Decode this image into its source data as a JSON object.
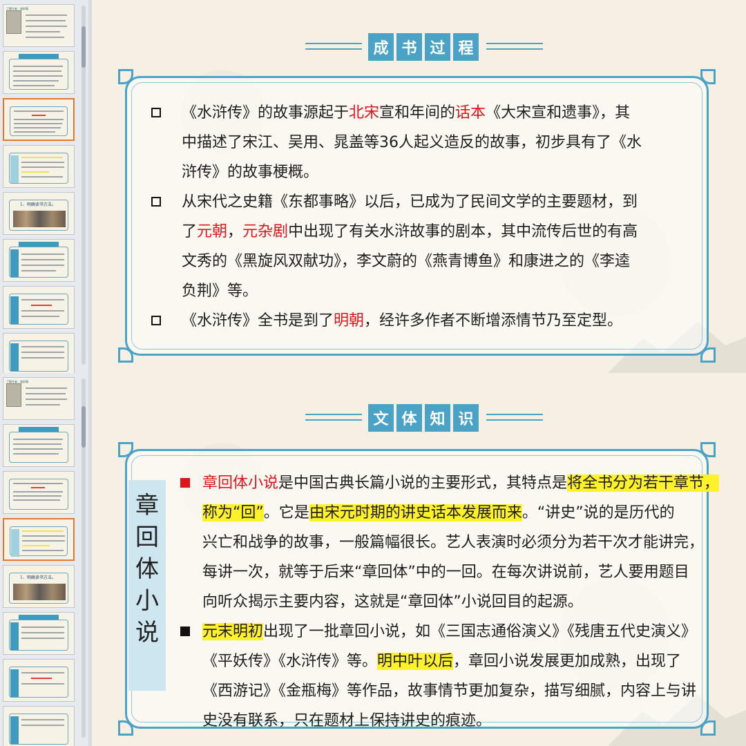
{
  "top_slide": {
    "heading": [
      "成",
      "书",
      "过",
      "程"
    ],
    "paragraphs": [
      {
        "bullet": "hollow-square",
        "lines": [
          [
            {
              "t": "《水浒传》的故事源起于"
            },
            {
              "t": "北宋",
              "c": "red"
            },
            {
              "t": "宣和年间的"
            },
            {
              "t": "话本",
              "c": "red"
            },
            {
              "t": "《大宋宣和遗事》，其"
            }
          ],
          [
            {
              "t": "中描述了宋江、吴用、晁盖等36人起义造反的故事，初步具有了《水"
            }
          ],
          [
            {
              "t": "浒传》的故事梗概。"
            }
          ]
        ]
      },
      {
        "bullet": "hollow-square",
        "lines": [
          [
            {
              "t": "从宋代之史籍《东都事略》以后，已成为了民间文学的主要题材，到"
            }
          ],
          [
            {
              "t": "了"
            },
            {
              "t": "元朝",
              "c": "red"
            },
            {
              "t": "，"
            },
            {
              "t": "元杂剧",
              "c": "red"
            },
            {
              "t": "中出现了有关水浒故事的剧本，其中流传后世的有高"
            }
          ],
          [
            {
              "t": "文秀的《黑旋风双献功》，李文蔚的《燕青博鱼》和康进之的《李逵"
            }
          ],
          [
            {
              "t": "负荆》等。"
            }
          ]
        ]
      },
      {
        "bullet": "hollow-square",
        "lines": [
          [
            {
              "t": "《水浒传》全书是到了"
            },
            {
              "t": "明朝",
              "c": "red"
            },
            {
              "t": "，经许多作者不断增添情节乃至定型。"
            }
          ]
        ]
      }
    ]
  },
  "bottom_slide": {
    "heading": [
      "文",
      "体",
      "知",
      "识"
    ],
    "side_label": [
      "章",
      "回",
      "体",
      "小",
      "说"
    ],
    "paragraphs": [
      {
        "bullet": "red-square",
        "lines": [
          [
            {
              "t": "章回体小说",
              "c": "red"
            },
            {
              "t": "是中国古典长篇小说的主要形式，其特点是"
            },
            {
              "t": "将全书分为若干章节，",
              "h": 1
            }
          ],
          [
            {
              "t": "称为“回”",
              "h": 1
            },
            {
              "t": "。它是"
            },
            {
              "t": "由宋元时期的讲史话本发展而来",
              "h": 1
            },
            {
              "t": "。“讲史”说的是历代的"
            }
          ],
          [
            {
              "t": "兴亡和战争的故事，一般篇幅很长。艺人表演时必须分为若干次才能讲完，"
            }
          ],
          [
            {
              "t": "每讲一次，就等于后来“章回体”中的一回。在每次讲说前，艺人要用题目"
            }
          ],
          [
            {
              "t": "向听众揭示主要内容，这就是“章回体”小说回目的起源。"
            }
          ]
        ]
      },
      {
        "bullet": "black-square",
        "lines": [
          [
            {
              "t": "元末明初",
              "h": 1
            },
            {
              "t": "出现了一批章回小说，如《三国志通俗演义》《残唐五代史演义》"
            }
          ],
          [
            {
              "t": "《平妖传》《水浒传》等。"
            },
            {
              "t": "明中叶以后",
              "h": 1
            },
            {
              "t": "，章回小说发展更加成熟，出现了"
            }
          ],
          [
            {
              "t": "《西游记》《金瓶梅》等作品，故事情节更加复杂，描写细腻，内容上与讲"
            }
          ],
          [
            {
              "t": "史没有联系，只在题材上保持讲史的痕迹。"
            }
          ]
        ]
      }
    ]
  },
  "thumbnails": {
    "first_title": "了解作者：施耐庵",
    "people_title": "1、明确读书方法。",
    "active_index_top": 2,
    "active_index_bottom": 3
  },
  "colors": {
    "accent": "#4aa2c6",
    "red": "#e0141a",
    "highlight": "#fff12a",
    "background": "#f5f0e3"
  }
}
